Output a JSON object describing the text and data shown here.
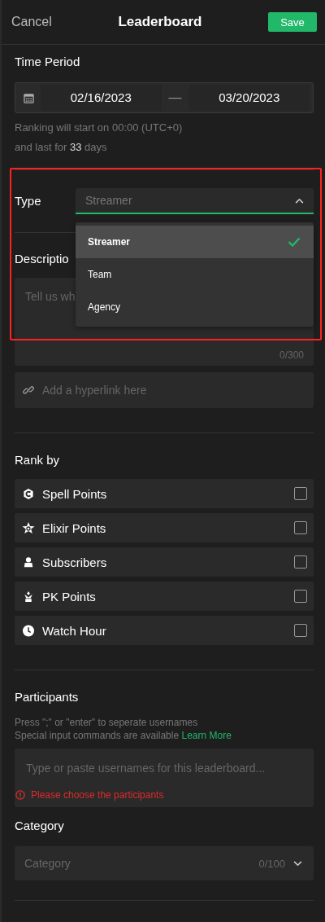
{
  "header": {
    "cancel": "Cancel",
    "title": "Leaderboard",
    "save": "Save"
  },
  "time_period": {
    "label": "Time Period",
    "start": "02/16/2023",
    "separator": "—",
    "end": "03/20/2023",
    "hint_1": "Ranking will start on 00:00 (UTC+0)",
    "hint_2": "and last for **33** days"
  },
  "type": {
    "label": "Type",
    "value": "Streamer",
    "expanded": true,
    "highlighted": true,
    "options": [
      {
        "label": "Streamer",
        "selected": true
      },
      {
        "label": "Team",
        "selected": false
      },
      {
        "label": "Agency",
        "selected": false
      }
    ]
  },
  "description": {
    "label": "Descriptio",
    "placeholder": "Tell us wh",
    "counter": "0/300",
    "link_placeholder": "Add a hyperlink here"
  },
  "rank_by": {
    "label": "Rank by",
    "items": [
      {
        "label": "Spell Points",
        "checked": false
      },
      {
        "label": "Elixir Points",
        "checked": false
      },
      {
        "label": "Subscribers",
        "checked": false
      },
      {
        "label": "PK Points",
        "checked": false
      },
      {
        "label": "Watch Hour",
        "checked": false
      }
    ]
  },
  "participants": {
    "label": "Participants",
    "hint_1": "Press \";\" or \"enter\" to seperate usernames",
    "hint_2": "Special input commands are available",
    "link": "Learn More",
    "placeholder": "Type or paste usernames for this leaderboard...",
    "error": "Please choose the participants"
  },
  "category": {
    "label": "Category",
    "placeholder": "Category",
    "counter": "0/100"
  }
}
